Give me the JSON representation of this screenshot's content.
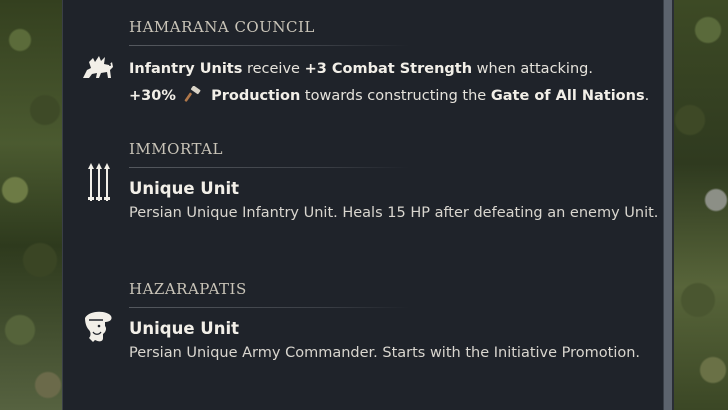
{
  "sections": [
    {
      "heading": "HAMARANA COUNCIL",
      "icon": "winged-lion-icon",
      "line1": {
        "p1": "Infantry Units",
        "p2": " receive ",
        "p3": "+3 Combat Strength",
        "p4": " when attacking."
      },
      "line2": {
        "p1": "+30%",
        "icon": "hammer-production-icon",
        "p2": "Production",
        "p3": " towards constructing the ",
        "p4": "Gate of All Nations",
        "p5": "."
      }
    },
    {
      "heading": "IMMORTAL",
      "icon": "three-spears-icon",
      "title": "Unique Unit",
      "description": "Persian Unique Infantry Unit. Heals 15 HP after defeating an enemy Unit."
    },
    {
      "heading": "HAZARAPATIS",
      "icon": "commander-head-icon",
      "title": "Unique Unit",
      "description": "Persian Unique Army Commander. Starts with the Initiative Promotion."
    }
  ]
}
